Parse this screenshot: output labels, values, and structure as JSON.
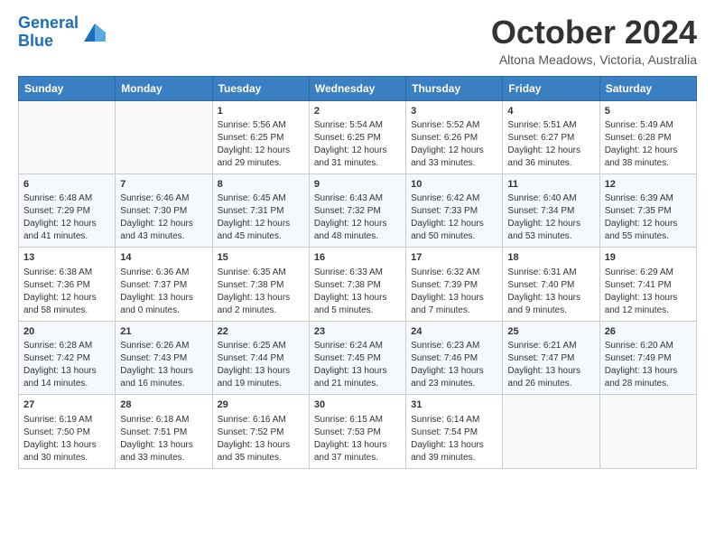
{
  "header": {
    "logo_line1": "General",
    "logo_line2": "Blue",
    "month": "October 2024",
    "location": "Altona Meadows, Victoria, Australia"
  },
  "days_of_week": [
    "Sunday",
    "Monday",
    "Tuesday",
    "Wednesday",
    "Thursday",
    "Friday",
    "Saturday"
  ],
  "weeks": [
    [
      {
        "day": "",
        "info": ""
      },
      {
        "day": "",
        "info": ""
      },
      {
        "day": "1",
        "info": "Sunrise: 5:56 AM\nSunset: 6:25 PM\nDaylight: 12 hours and 29 minutes."
      },
      {
        "day": "2",
        "info": "Sunrise: 5:54 AM\nSunset: 6:25 PM\nDaylight: 12 hours and 31 minutes."
      },
      {
        "day": "3",
        "info": "Sunrise: 5:52 AM\nSunset: 6:26 PM\nDaylight: 12 hours and 33 minutes."
      },
      {
        "day": "4",
        "info": "Sunrise: 5:51 AM\nSunset: 6:27 PM\nDaylight: 12 hours and 36 minutes."
      },
      {
        "day": "5",
        "info": "Sunrise: 5:49 AM\nSunset: 6:28 PM\nDaylight: 12 hours and 38 minutes."
      }
    ],
    [
      {
        "day": "6",
        "info": "Sunrise: 6:48 AM\nSunset: 7:29 PM\nDaylight: 12 hours and 41 minutes."
      },
      {
        "day": "7",
        "info": "Sunrise: 6:46 AM\nSunset: 7:30 PM\nDaylight: 12 hours and 43 minutes."
      },
      {
        "day": "8",
        "info": "Sunrise: 6:45 AM\nSunset: 7:31 PM\nDaylight: 12 hours and 45 minutes."
      },
      {
        "day": "9",
        "info": "Sunrise: 6:43 AM\nSunset: 7:32 PM\nDaylight: 12 hours and 48 minutes."
      },
      {
        "day": "10",
        "info": "Sunrise: 6:42 AM\nSunset: 7:33 PM\nDaylight: 12 hours and 50 minutes."
      },
      {
        "day": "11",
        "info": "Sunrise: 6:40 AM\nSunset: 7:34 PM\nDaylight: 12 hours and 53 minutes."
      },
      {
        "day": "12",
        "info": "Sunrise: 6:39 AM\nSunset: 7:35 PM\nDaylight: 12 hours and 55 minutes."
      }
    ],
    [
      {
        "day": "13",
        "info": "Sunrise: 6:38 AM\nSunset: 7:36 PM\nDaylight: 12 hours and 58 minutes."
      },
      {
        "day": "14",
        "info": "Sunrise: 6:36 AM\nSunset: 7:37 PM\nDaylight: 13 hours and 0 minutes."
      },
      {
        "day": "15",
        "info": "Sunrise: 6:35 AM\nSunset: 7:38 PM\nDaylight: 13 hours and 2 minutes."
      },
      {
        "day": "16",
        "info": "Sunrise: 6:33 AM\nSunset: 7:38 PM\nDaylight: 13 hours and 5 minutes."
      },
      {
        "day": "17",
        "info": "Sunrise: 6:32 AM\nSunset: 7:39 PM\nDaylight: 13 hours and 7 minutes."
      },
      {
        "day": "18",
        "info": "Sunrise: 6:31 AM\nSunset: 7:40 PM\nDaylight: 13 hours and 9 minutes."
      },
      {
        "day": "19",
        "info": "Sunrise: 6:29 AM\nSunset: 7:41 PM\nDaylight: 13 hours and 12 minutes."
      }
    ],
    [
      {
        "day": "20",
        "info": "Sunrise: 6:28 AM\nSunset: 7:42 PM\nDaylight: 13 hours and 14 minutes."
      },
      {
        "day": "21",
        "info": "Sunrise: 6:26 AM\nSunset: 7:43 PM\nDaylight: 13 hours and 16 minutes."
      },
      {
        "day": "22",
        "info": "Sunrise: 6:25 AM\nSunset: 7:44 PM\nDaylight: 13 hours and 19 minutes."
      },
      {
        "day": "23",
        "info": "Sunrise: 6:24 AM\nSunset: 7:45 PM\nDaylight: 13 hours and 21 minutes."
      },
      {
        "day": "24",
        "info": "Sunrise: 6:23 AM\nSunset: 7:46 PM\nDaylight: 13 hours and 23 minutes."
      },
      {
        "day": "25",
        "info": "Sunrise: 6:21 AM\nSunset: 7:47 PM\nDaylight: 13 hours and 26 minutes."
      },
      {
        "day": "26",
        "info": "Sunrise: 6:20 AM\nSunset: 7:49 PM\nDaylight: 13 hours and 28 minutes."
      }
    ],
    [
      {
        "day": "27",
        "info": "Sunrise: 6:19 AM\nSunset: 7:50 PM\nDaylight: 13 hours and 30 minutes."
      },
      {
        "day": "28",
        "info": "Sunrise: 6:18 AM\nSunset: 7:51 PM\nDaylight: 13 hours and 33 minutes."
      },
      {
        "day": "29",
        "info": "Sunrise: 6:16 AM\nSunset: 7:52 PM\nDaylight: 13 hours and 35 minutes."
      },
      {
        "day": "30",
        "info": "Sunrise: 6:15 AM\nSunset: 7:53 PM\nDaylight: 13 hours and 37 minutes."
      },
      {
        "day": "31",
        "info": "Sunrise: 6:14 AM\nSunset: 7:54 PM\nDaylight: 13 hours and 39 minutes."
      },
      {
        "day": "",
        "info": ""
      },
      {
        "day": "",
        "info": ""
      }
    ]
  ]
}
